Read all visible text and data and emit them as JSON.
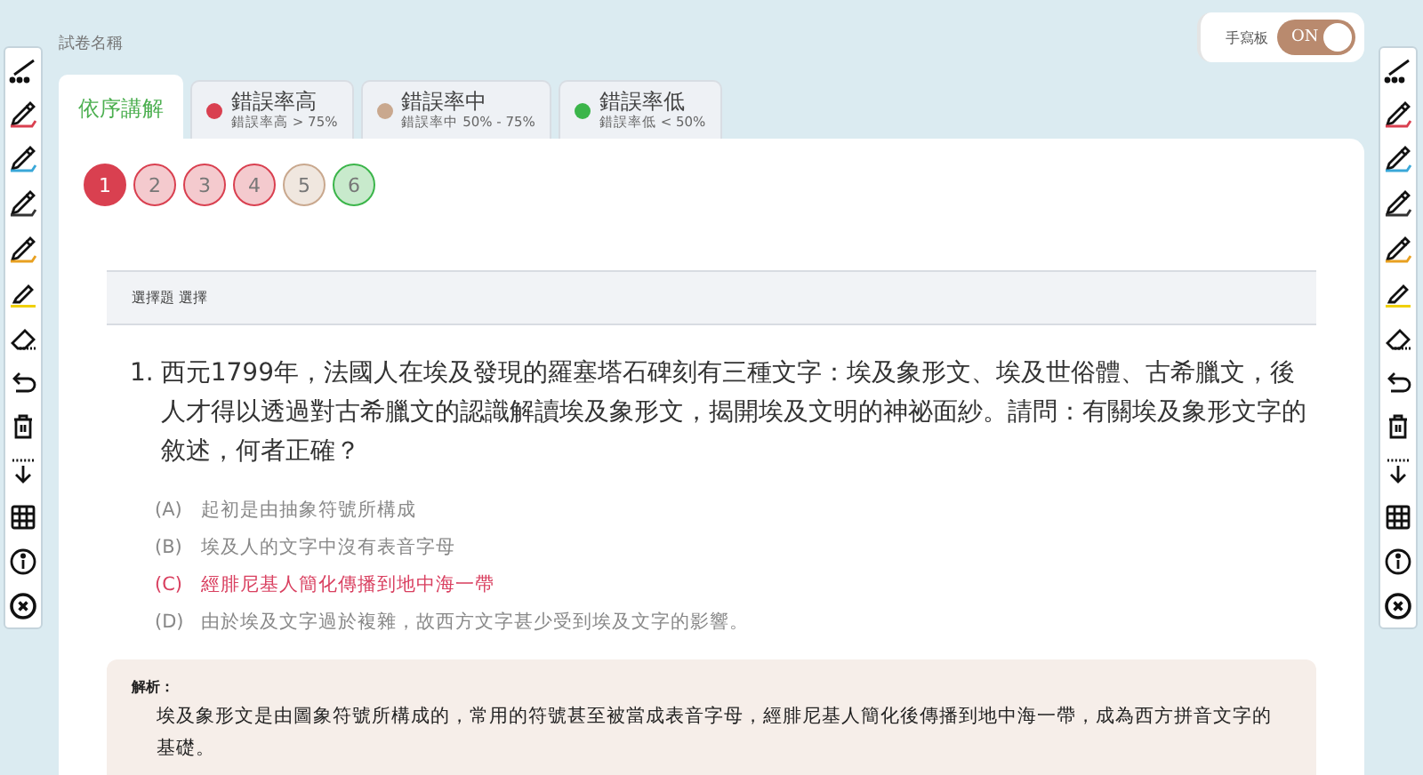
{
  "exam_title": "試卷名稱",
  "handwriting_toggle": {
    "label": "手寫板",
    "state_text": "ON",
    "on": true
  },
  "tabs": [
    {
      "label": "依序講解",
      "selected": true
    },
    {
      "label": "錯誤率高",
      "sublabel": "錯誤率高 > 75%",
      "color": "#d94050",
      "selected": false
    },
    {
      "label": "錯誤率中",
      "sublabel": "錯誤率中 50% - 75%",
      "color": "#c9a88e",
      "selected": false
    },
    {
      "label": "錯誤率低",
      "sublabel": "錯誤率低 < 50%",
      "color": "#3bb54a",
      "selected": false
    }
  ],
  "question_numbers": [
    {
      "label": "1",
      "color": "#d94050",
      "selected": true
    },
    {
      "label": "2",
      "color": "#d94050",
      "selected": false
    },
    {
      "label": "3",
      "color": "#d94050",
      "selected": false
    },
    {
      "label": "4",
      "color": "#d94050",
      "selected": false
    },
    {
      "label": "5",
      "color": "#c9a88e",
      "selected": false
    },
    {
      "label": "6",
      "color": "#3bb54a",
      "selected": false
    }
  ],
  "question_type": "選擇題 選擇",
  "question": {
    "number": "1.",
    "text": "西元1799年，法國人在埃及發現的羅塞塔石碑刻有三種文字：埃及象形文、埃及世俗體、古希臘文，後人才得以透過對古希臘文的認識解讀埃及象形文，揭開埃及文明的神祕面紗。請問：有關埃及象形文字的敘述，何者正確？"
  },
  "options": [
    {
      "letter": "(A)",
      "text": "起初是由抽象符號所構成",
      "correct": false
    },
    {
      "letter": "(B)",
      "text": "埃及人的文字中沒有表音字母",
      "correct": false
    },
    {
      "letter": "(C)",
      "text": "經腓尼基人簡化傳播到地中海一帶",
      "correct": true
    },
    {
      "letter": "(D)",
      "text": "由於埃及文字過於複雜，故西方文字甚少受到埃及文字的影響。",
      "correct": false
    }
  ],
  "analysis": {
    "label": "解析：",
    "text": "埃及象形文是由圖象符號所構成的，常用的符號甚至被當成表音字母，經腓尼基人簡化後傳播到地中海一帶，成為西方拼音文字的基礎。"
  }
}
